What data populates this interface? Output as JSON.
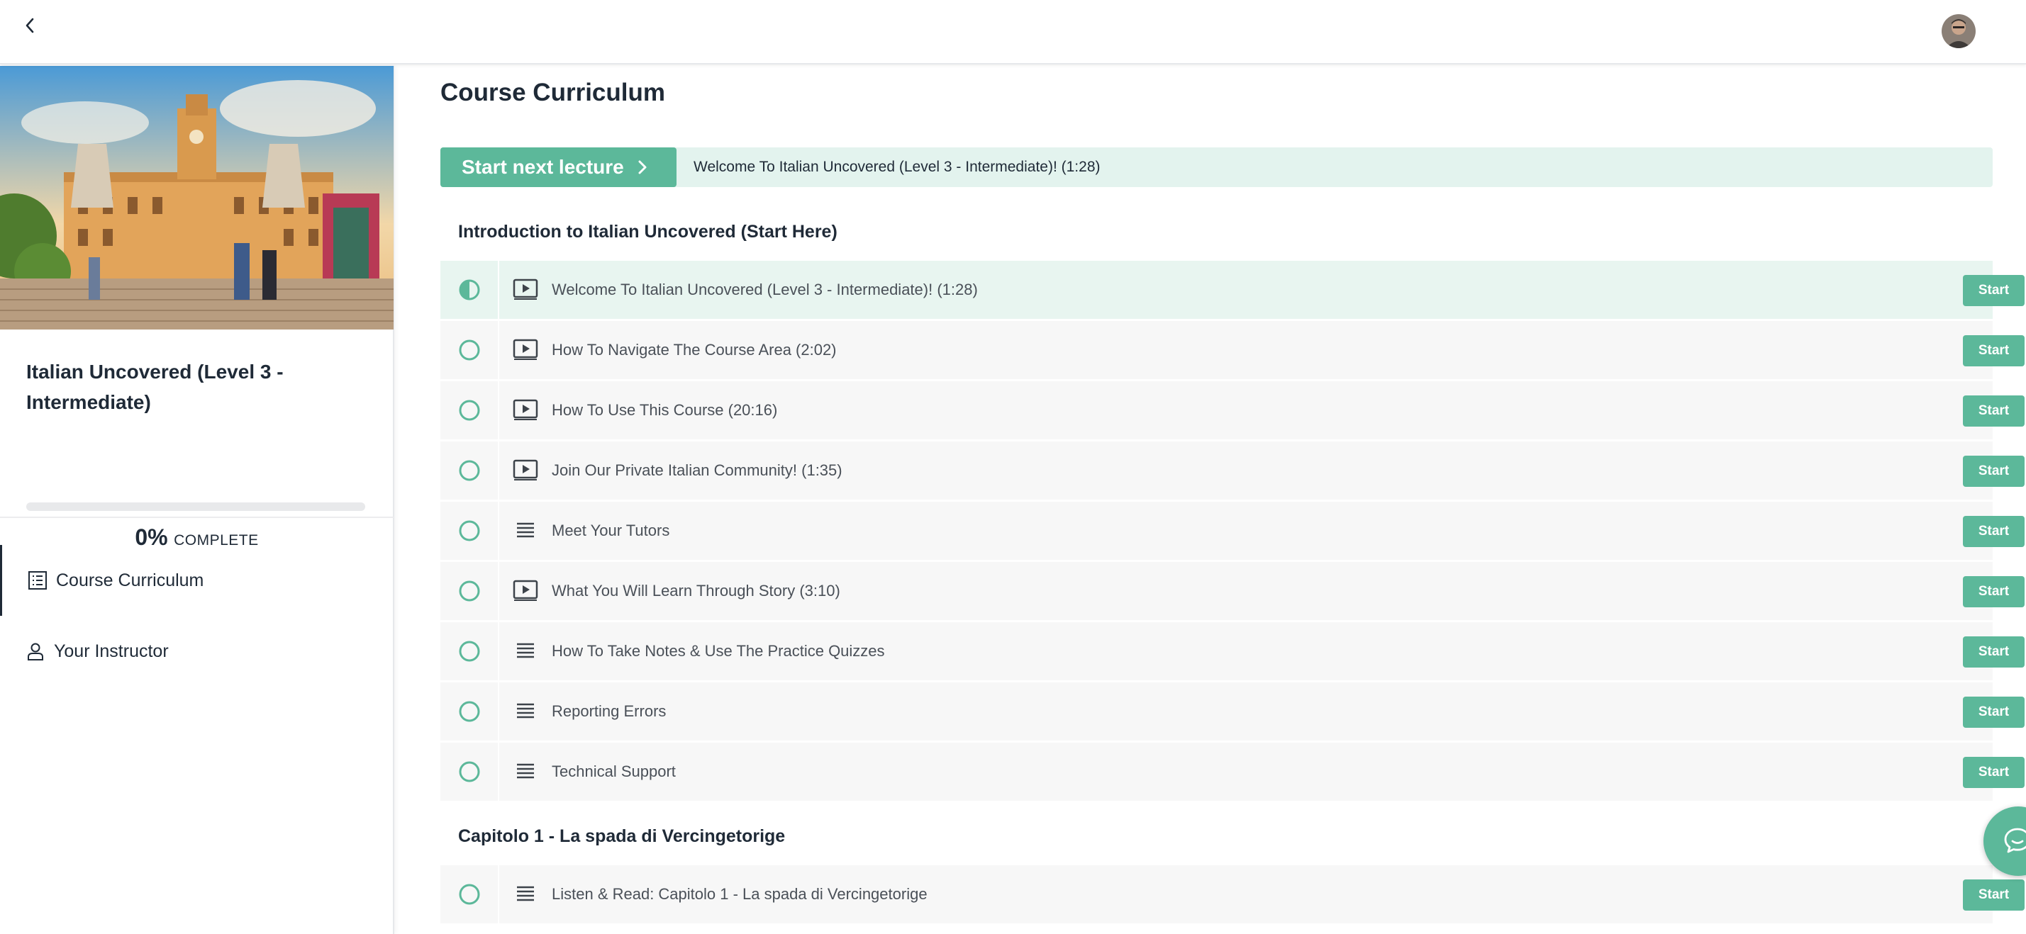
{
  "course": {
    "title": "Italian Uncovered (Level 3 - Intermediate)",
    "progress_percent": "0%",
    "progress_label": "COMPLETE",
    "progress_value": 0
  },
  "sidebar": {
    "nav": [
      {
        "label": "Course Curriculum",
        "icon": "curriculum-list-icon",
        "active": true
      },
      {
        "label": "Your Instructor",
        "icon": "person-icon",
        "active": false
      }
    ]
  },
  "main": {
    "title": "Course Curriculum",
    "next_lecture": {
      "button_label": "Start next lecture",
      "lecture_name": "Welcome To Italian Uncovered (Level 3 - Intermediate)! (1:28)"
    },
    "sections": [
      {
        "title": "Introduction to Italian Uncovered (Start Here)",
        "lectures": [
          {
            "name": "Welcome To Italian Uncovered (Level 3 - Intermediate)! (1:28)",
            "type": "video-icon",
            "status": "in-progress",
            "button": "Start"
          },
          {
            "name": "How To Navigate The Course Area (2:02)",
            "type": "video-icon",
            "status": "not-started",
            "button": "Start"
          },
          {
            "name": "How To Use This Course (20:16)",
            "type": "video-icon",
            "status": "not-started",
            "button": "Start"
          },
          {
            "name": "Join Our Private Italian Community! (1:35)",
            "type": "video-icon",
            "status": "not-started",
            "button": "Start"
          },
          {
            "name": "Meet Your Tutors",
            "type": "text-lines-icon",
            "status": "not-started",
            "button": "Start"
          },
          {
            "name": "What You Will Learn Through Story (3:10)",
            "type": "video-icon",
            "status": "not-started",
            "button": "Start"
          },
          {
            "name": "How To Take Notes & Use The Practice Quizzes",
            "type": "text-lines-icon",
            "status": "not-started",
            "button": "Start"
          },
          {
            "name": "Reporting Errors",
            "type": "text-lines-icon",
            "status": "not-started",
            "button": "Start"
          },
          {
            "name": "Technical Support",
            "type": "text-lines-icon",
            "status": "not-started",
            "button": "Start"
          }
        ]
      },
      {
        "title": "Capitolo 1 - La spada di Vercingetorige",
        "lectures": [
          {
            "name": "Listen & Read: Capitolo 1 - La spada di Vercingetorige",
            "type": "text-lines-icon",
            "status": "not-started",
            "button": "Start"
          }
        ]
      }
    ]
  },
  "colors": {
    "accent": "#5cb89a",
    "accent_light": "#e3f3ee",
    "row_bg": "#f7f7f7",
    "text_dark": "#1f2a37",
    "text_muted": "#4a5058"
  }
}
